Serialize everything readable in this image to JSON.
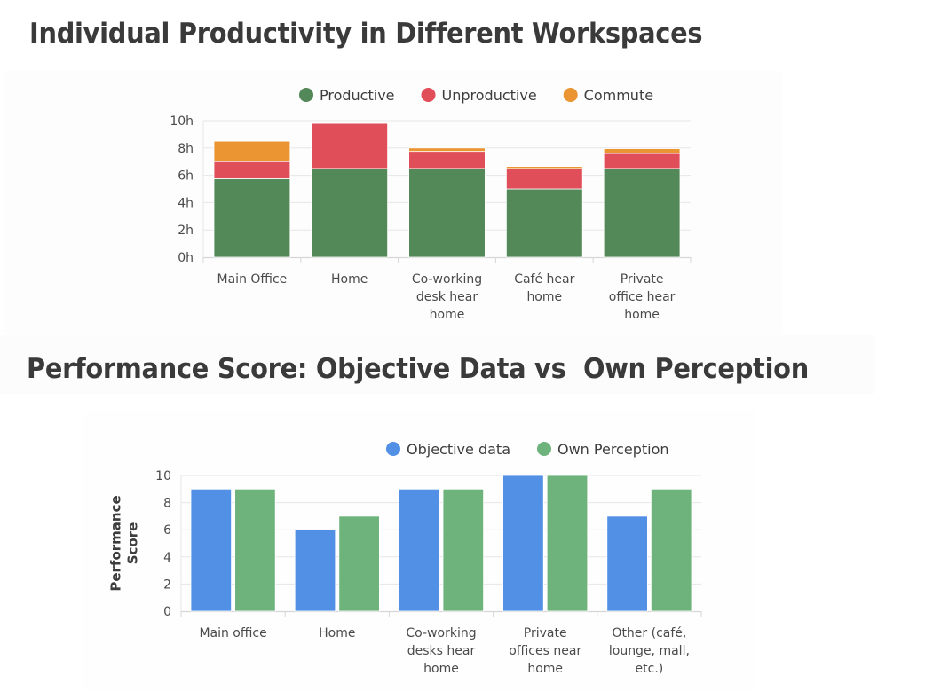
{
  "chart_data": [
    {
      "type": "bar",
      "stacked": true,
      "title": "Individual Productivity in Different Workspaces",
      "xlabel": "",
      "ylabel": "",
      "categories": [
        [
          "Main Office"
        ],
        [
          "Home"
        ],
        [
          "Co-working",
          "desk hear",
          "home"
        ],
        [
          "Café hear",
          "home"
        ],
        [
          "Private",
          "office hear",
          "home"
        ]
      ],
      "series": [
        {
          "name": "Productive",
          "color": "#538859",
          "values": [
            5.75,
            6.5,
            6.5,
            5.0,
            6.5
          ]
        },
        {
          "name": "Unproductive",
          "color": "#e04e59",
          "values": [
            1.25,
            3.3,
            1.25,
            1.5,
            1.1
          ]
        },
        {
          "name": "Commute",
          "color": "#ea9432",
          "values": [
            1.5,
            0,
            0.25,
            0.15,
            0.35
          ]
        }
      ],
      "ylim": [
        0,
        10
      ],
      "yticks": [
        0,
        2,
        4,
        6,
        8,
        10
      ],
      "ytick_labels": [
        "0h",
        "2h",
        "4h",
        "6h",
        "8h",
        "10h"
      ],
      "grid": true,
      "legend_position": "top"
    },
    {
      "type": "bar",
      "stacked": false,
      "title": "Performance Score: Objective Data vs  Own Perception",
      "xlabel": "",
      "ylabel": [
        "Performance",
        "Score"
      ],
      "categories": [
        [
          "Main office"
        ],
        [
          "Home"
        ],
        [
          "Co-working",
          "desks hear",
          "home"
        ],
        [
          "Private",
          "offices near",
          "home"
        ],
        [
          "Other (café,",
          "lounge, mall,",
          "etc.)"
        ]
      ],
      "series": [
        {
          "name": "Objective data",
          "color": "#5290e6",
          "values": [
            9,
            6,
            9,
            10,
            7
          ]
        },
        {
          "name": "Own Perception",
          "color": "#6fb37c",
          "values": [
            9,
            7,
            9,
            10,
            9
          ]
        }
      ],
      "ylim": [
        0,
        10
      ],
      "yticks": [
        0,
        2,
        4,
        6,
        8,
        10
      ],
      "ytick_labels": [
        "0",
        "2",
        "4",
        "6",
        "8",
        "10"
      ],
      "grid": true,
      "legend_position": "top-right"
    }
  ]
}
